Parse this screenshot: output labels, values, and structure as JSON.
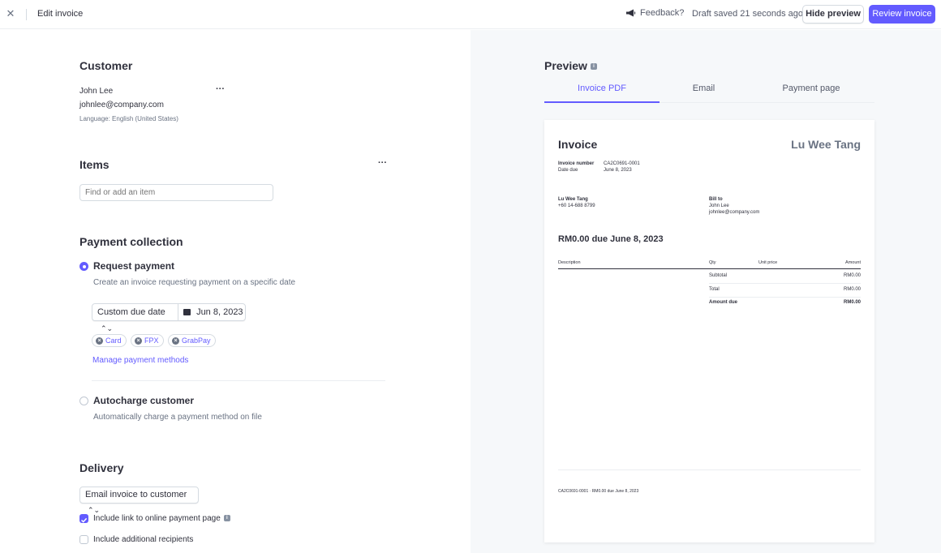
{
  "header": {
    "title": "Edit invoice",
    "feedback": "Feedback?",
    "draft_status": "Draft saved 21 seconds ago",
    "hide_preview": "Hide preview",
    "review_invoice": "Review invoice"
  },
  "customer": {
    "heading": "Customer",
    "name": "John Lee",
    "email": "johnlee@company.com",
    "language": "Language: English (United States)"
  },
  "items": {
    "heading": "Items",
    "search_placeholder": "Find or add an item"
  },
  "payment": {
    "heading": "Payment collection",
    "request_label": "Request payment",
    "request_desc": "Create an invoice requesting payment on a specific date",
    "due_select": "Custom due date",
    "due_date": "Jun 8, 2023",
    "methods": [
      "Card",
      "FPX",
      "GrabPay"
    ],
    "manage_link": "Manage payment methods",
    "autocharge_label": "Autocharge customer",
    "autocharge_desc": "Automatically charge a payment method on file",
    "selected": "request"
  },
  "delivery": {
    "heading": "Delivery",
    "select": "Email invoice to customer",
    "include_link": "Include link to online payment page",
    "include_link_checked": true,
    "additional": "Include additional recipients",
    "additional_checked": false
  },
  "preview": {
    "heading": "Preview",
    "tabs": [
      "Invoice PDF",
      "Email",
      "Payment page"
    ],
    "active_tab": 0
  },
  "invoice": {
    "title": "Invoice",
    "merchant": "Lu Wee Tang",
    "number_label": "Invoice number",
    "number": "CA2C0691-0001",
    "date_due_label": "Date due",
    "date_due": "June 8, 2023",
    "from_name": "Lu Wee Tang",
    "from_phone": "+60 14-688 8799",
    "bill_to_label": "Bill to",
    "bill_to_name": "John Lee",
    "bill_to_email": "johnlee@company.com",
    "amount_headline": "RM0.00 due June 8, 2023",
    "col_description": "Description",
    "col_qty": "Qty",
    "col_unit_price": "Unit price",
    "col_amount": "Amount",
    "subtotal_label": "Subtotal",
    "subtotal": "RM0.00",
    "total_label": "Total",
    "total": "RM0.00",
    "amount_due_label": "Amount due",
    "amount_due": "RM0.00",
    "footer": "CA2C0691-0001 · RM0.00 due June 8, 2023"
  },
  "colors": {
    "accent": "#635bff",
    "text": "#30313d",
    "muted": "#6a7383",
    "panel": "#f6f8fa"
  }
}
